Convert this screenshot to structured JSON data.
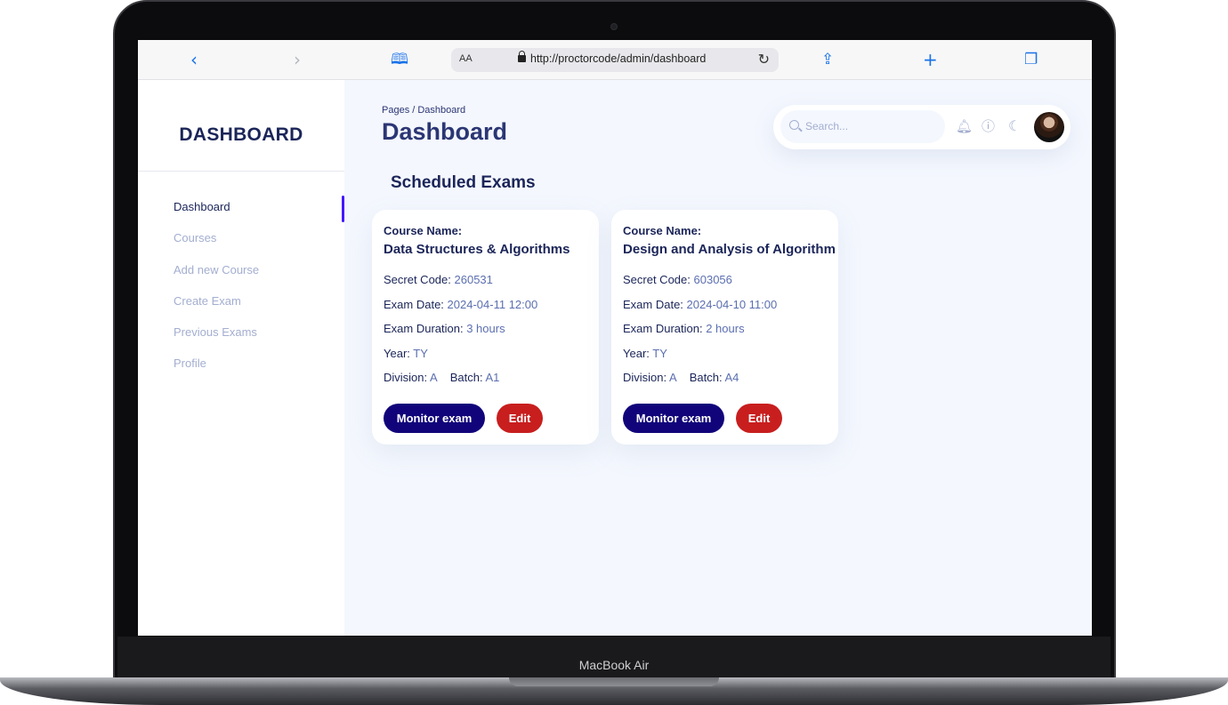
{
  "device": {
    "label": "MacBook Air"
  },
  "browser": {
    "text_size_label": "AA",
    "url": "http://proctorcode/admin/dashboard"
  },
  "sidebar": {
    "title": "DASHBOARD",
    "items": [
      {
        "label": "Dashboard",
        "active": true
      },
      {
        "label": "Courses",
        "active": false
      },
      {
        "label": "Add new Course",
        "active": false
      },
      {
        "label": "Create Exam",
        "active": false
      },
      {
        "label": "Previous Exams",
        "active": false
      },
      {
        "label": "Profile",
        "active": false
      }
    ]
  },
  "header": {
    "breadcrumb": "Pages / Dashboard",
    "title": "Dashboard",
    "search_placeholder": "Search..."
  },
  "section": {
    "title": "Scheduled Exams"
  },
  "labels": {
    "course_name": "Course Name:",
    "secret_code": "Secret Code:",
    "exam_date": "Exam Date:",
    "exam_duration": "Exam Duration:",
    "year": "Year:",
    "division": "Division:",
    "batch": "Batch:",
    "monitor_button": "Monitor exam",
    "edit_button": "Edit"
  },
  "exams": [
    {
      "course_name": "Data Structures & Algorithms",
      "secret_code": "260531",
      "exam_date": "2024-04-11 12:00",
      "exam_duration": "3 hours",
      "year": "TY",
      "division": "A",
      "batch": "A1"
    },
    {
      "course_name": "Design and Analysis of Algorithm",
      "secret_code": "603056",
      "exam_date": "2024-04-10 11:00",
      "exam_duration": "2 hours",
      "year": "TY",
      "division": "A",
      "batch": "A4"
    }
  ],
  "colors": {
    "primary_navy": "#11047a",
    "danger_red": "#c81e1e",
    "active_indicator": "#4318ff",
    "heading": "#1b2559",
    "muted": "#a3aed0",
    "value_text": "#5b6fb0",
    "page_bg": "#f4f7fe"
  }
}
